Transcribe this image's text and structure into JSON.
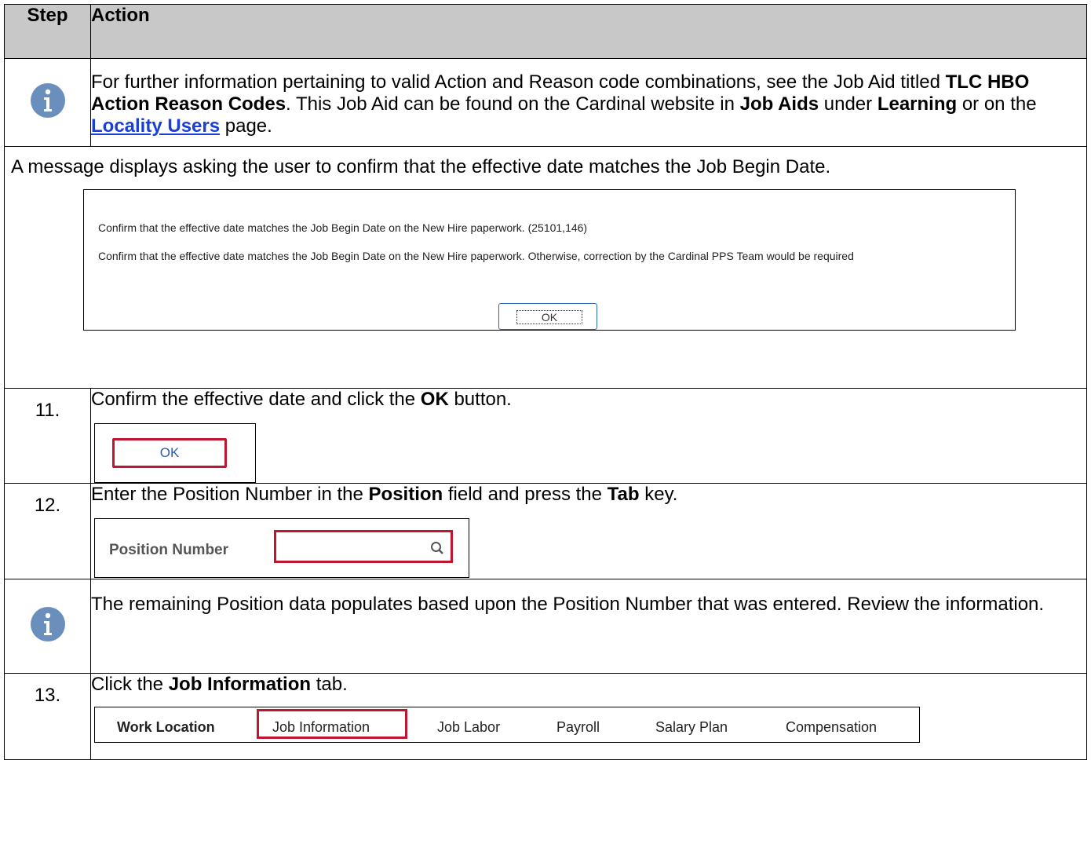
{
  "header": {
    "step": "Step",
    "action": "Action"
  },
  "row_info1": {
    "text_a": "For further information pertaining to valid Action and Reason code combinations, see the Job Aid titled ",
    "bold_a": "TLC HBO Action Reason Codes",
    "text_b": ". This Job Aid can be found on the Cardinal website in ",
    "bold_b": "Job Aids",
    "text_c": " under ",
    "bold_c": "Learning",
    "text_d": " or on the ",
    "link": "Locality Users",
    "text_e": " page."
  },
  "row_message": {
    "text": "A message displays asking the user to confirm that the effective date matches the Job Begin Date.",
    "dialog": {
      "line1": "Confirm that the effective date matches the Job Begin Date on the New Hire paperwork. (25101,146)",
      "line2": "Confirm that the effective date matches the Job Begin Date on the New Hire paperwork.  Otherwise, correction by the Cardinal PPS Team would be required",
      "ok": "OK"
    }
  },
  "step11": {
    "num": "11.",
    "text_a": "Confirm the effective date and click the ",
    "bold_a": "OK",
    "text_b": " button.",
    "ok_label": "OK"
  },
  "step12": {
    "num": "12.",
    "text_a": "Enter the Position Number in the ",
    "bold_a": "Position",
    "text_b": " field and press the ",
    "bold_b": "Tab",
    "text_c": " key.",
    "field_label": "Position Number",
    "field_value": ""
  },
  "row_info2": {
    "text": "The remaining Position data populates based upon the Position Number that was entered. Review the information."
  },
  "step13": {
    "num": "13.",
    "text_a": "Click the ",
    "bold_a": "Job Information",
    "text_b": " tab.",
    "tabs": [
      "Work Location",
      "Job Information",
      "Job Labor",
      "Payroll",
      "Salary Plan",
      "Compensation"
    ]
  },
  "colors": {
    "accent_red": "#c0152f",
    "info_blue": "#6b8fbd",
    "link_blue": "#1a3fd6"
  }
}
